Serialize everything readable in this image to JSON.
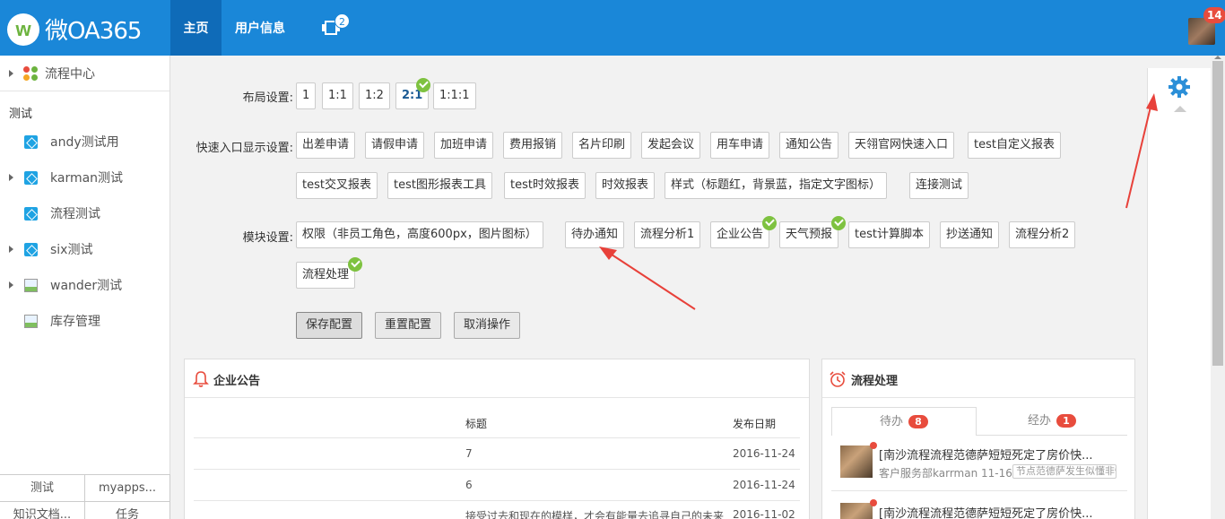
{
  "topbar": {
    "logo_mark": "w",
    "logo_text": "微OA365",
    "nav": [
      "主页",
      "用户信息"
    ],
    "nav_badge": "2",
    "avatar_badge": "14"
  },
  "sidebar": {
    "top_item": "流程中心",
    "section_label": "测试",
    "items": [
      {
        "label": "andy测试用",
        "icon": "cube-icon",
        "expandable": false
      },
      {
        "label": "karman测试",
        "icon": "cube-icon",
        "expandable": true
      },
      {
        "label": "流程测试",
        "icon": "cube-icon",
        "expandable": false
      },
      {
        "label": "six测试",
        "icon": "cube-icon",
        "expandable": true
      },
      {
        "label": "wander测试",
        "icon": "image-icon",
        "expandable": true
      },
      {
        "label": "库存管理",
        "icon": "image-icon",
        "expandable": false
      }
    ],
    "bottom_tabs": [
      "测试",
      "myapps..."
    ],
    "bottom_tabs2": [
      "知识文档...",
      "任务"
    ]
  },
  "settings": {
    "layout_label": "布局设置:",
    "layouts": [
      "1",
      "1:1",
      "1:2",
      "2:1",
      "1:1:1"
    ],
    "layout_selected": "2:1",
    "quick_label": "快速入口显示设置:",
    "quick_row1": [
      "出差申请",
      "请假申请",
      "加班申请",
      "费用报销",
      "名片印刷",
      "发起会议",
      "用车申请",
      "通知公告",
      "天翎官网快速入口",
      "test自定义报表"
    ],
    "quick_row2": [
      "test交叉报表",
      "test图形报表工具",
      "test时效报表",
      "时效报表",
      "样式（标题红，背景蓝，指定文字图标）",
      "连接测试"
    ],
    "module_label": "模块设置:",
    "modules_row1": [
      "权限（非员工角色，高度600px，图片图标）",
      "待办通知",
      "流程分析1",
      "企业公告",
      "天气预报",
      "test计算脚本",
      "抄送通知",
      "流程分析2"
    ],
    "modules_row2": [
      "流程处理"
    ],
    "buttons": [
      "保存配置",
      "重置配置",
      "取消操作"
    ]
  },
  "notice_card": {
    "title": "企业公告",
    "col_title": "标题",
    "col_date": "发布日期",
    "rows": [
      {
        "title": "7",
        "date": "2016-11-24"
      },
      {
        "title": "6",
        "date": "2016-11-24"
      },
      {
        "title": "接受过去和现在的模样，才会有能量去追寻自己的未来",
        "date": "2016-11-02"
      }
    ]
  },
  "flow_card": {
    "title": "流程处理",
    "tab_todo": "待办",
    "tab_todo_count": "8",
    "tab_done": "经办",
    "tab_done_count": "1",
    "items": [
      {
        "title": "[南沙流程流程范德萨短短死定了房价快...",
        "sub": "客户服务部karrman  11-16",
        "tag": "节点范德萨发生似懂非懂"
      },
      {
        "title": "[南沙流程流程范德萨短短死定了房价快...",
        "sub": "",
        "tag": ""
      }
    ]
  },
  "colors": {
    "topbar": "#1a87d8",
    "accent_red": "#e84c3d",
    "check_green": "#7ec240",
    "arrow_red": "#e8413a"
  }
}
